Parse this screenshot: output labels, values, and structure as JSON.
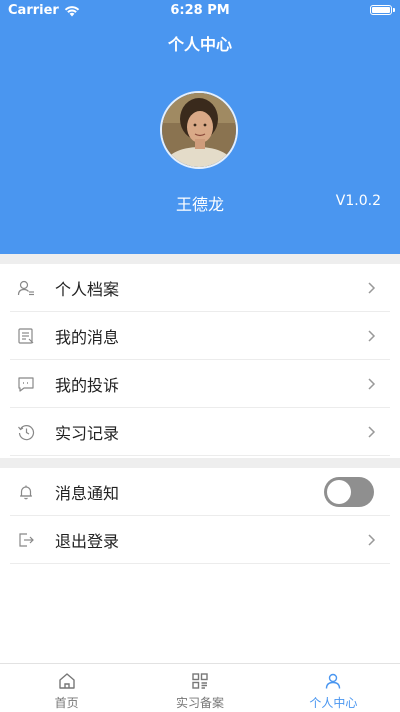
{
  "status_bar": {
    "carrier": "Carrier",
    "time": "6:28 PM"
  },
  "header": {
    "title": "个人中心",
    "username": "王德龙",
    "version": "V1.0.2",
    "color": "#4a96f0"
  },
  "menu": {
    "items": [
      {
        "label": "个人档案",
        "icon": "profile-icon"
      },
      {
        "label": "我的消息",
        "icon": "message-icon"
      },
      {
        "label": "我的投诉",
        "icon": "complaint-icon"
      },
      {
        "label": "实习记录",
        "icon": "history-icon"
      }
    ]
  },
  "settings": {
    "notification_label": "消息通知",
    "notification_enabled": false,
    "logout_label": "退出登录"
  },
  "tabbar": {
    "tabs": [
      {
        "label": "首页",
        "icon": "home-icon",
        "active": false
      },
      {
        "label": "实习备案",
        "icon": "grid-icon",
        "active": false
      },
      {
        "label": "个人中心",
        "icon": "person-icon",
        "active": true
      }
    ]
  }
}
